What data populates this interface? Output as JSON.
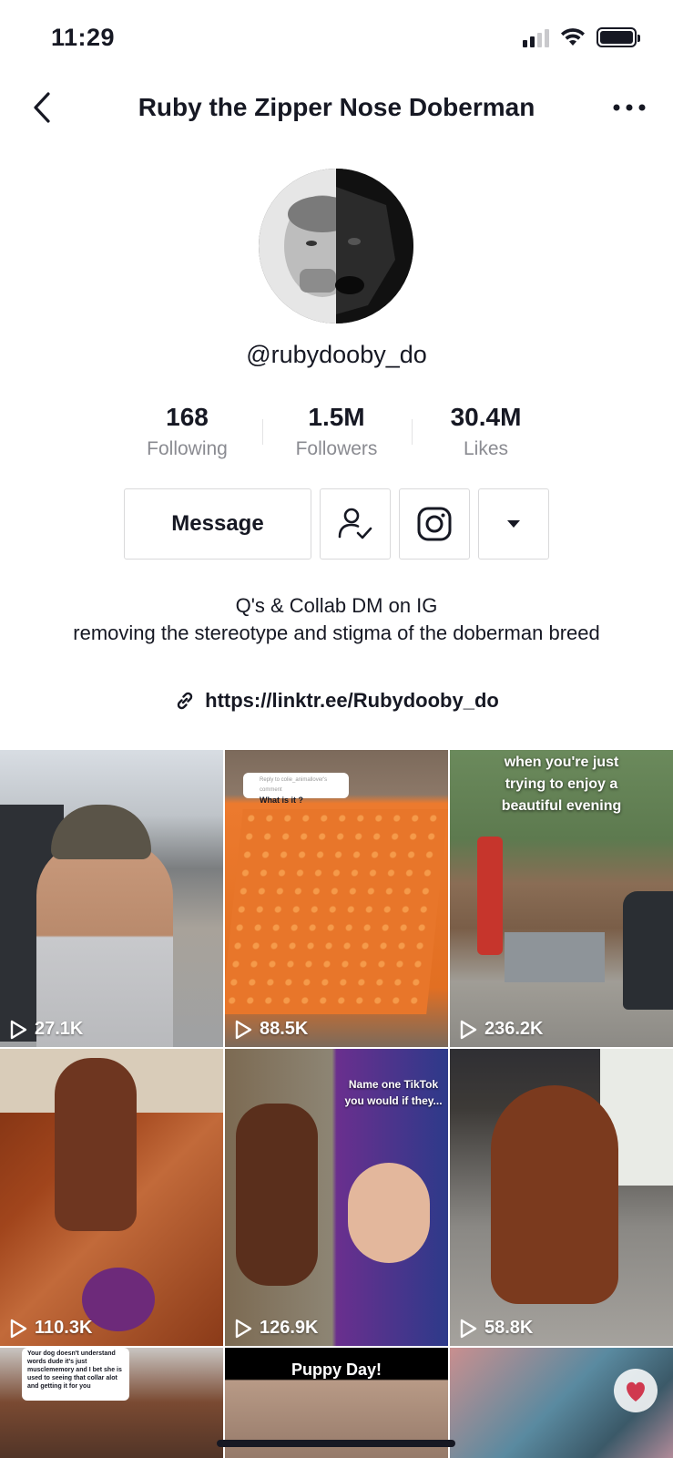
{
  "status_bar": {
    "time": "11:29"
  },
  "nav": {
    "title": "Ruby the Zipper Nose Doberman"
  },
  "profile": {
    "username": "@rubydooby_do",
    "stats": [
      {
        "value": "168",
        "label": "Following"
      },
      {
        "value": "1.5M",
        "label": "Followers"
      },
      {
        "value": "30.4M",
        "label": "Likes"
      }
    ],
    "message_label": "Message",
    "bio_lines": [
      "Q's & Collab DM on IG",
      "removing the stereotype and stigma of the doberman breed"
    ],
    "link": "https://linktr.ee/Rubydooby_do"
  },
  "videos": [
    {
      "views": "27.1K"
    },
    {
      "views": "88.5K",
      "comment_header": "Reply to colie_animallover's comment",
      "comment_text": "What is it ?"
    },
    {
      "views": "236.2K",
      "caption": "when you're just trying to enjoy a beautiful evening"
    },
    {
      "views": "110.3K"
    },
    {
      "views": "126.9K",
      "caption": "Name one TikTok you would if they..."
    },
    {
      "views": "58.8K"
    },
    {
      "caption": "Your dog doesn't understand words dude it's just musclememory and I bet she is used to seeing that collar alot and getting it for you"
    },
    {
      "caption": "Puppy Day!"
    },
    {}
  ]
}
